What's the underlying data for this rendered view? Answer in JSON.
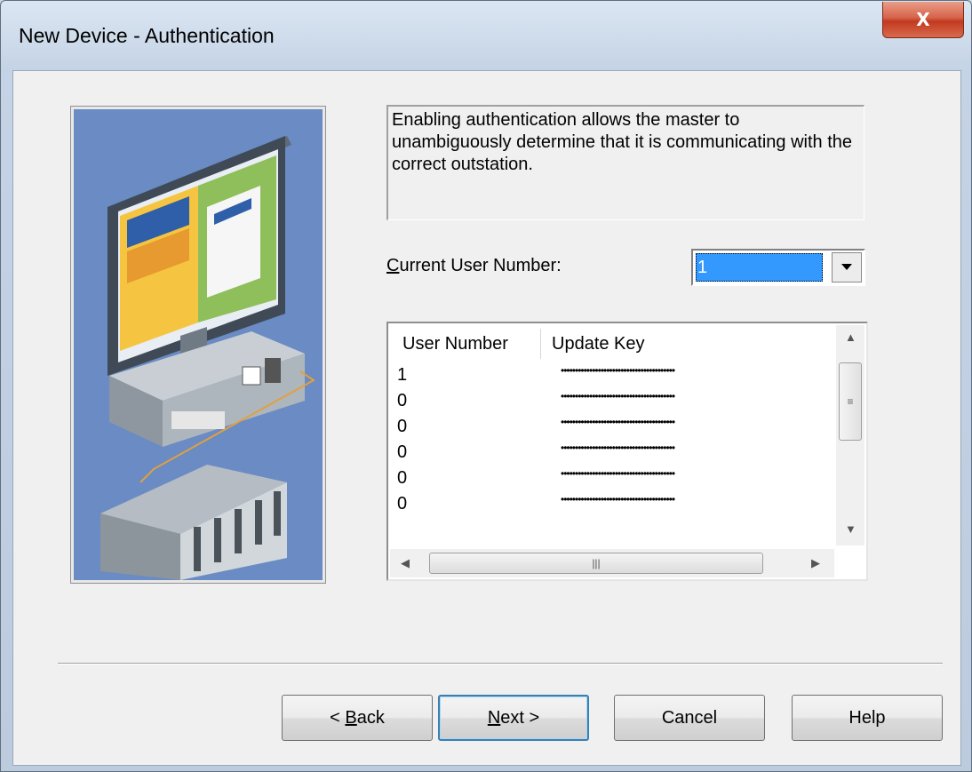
{
  "window": {
    "title": "New Device - Authentication",
    "close_glyph": "X"
  },
  "description": "Enabling authentication allows the master to unambiguously determine that it is communicating with the correct outstation.",
  "current_user": {
    "label_mnemonic": "C",
    "label_rest": "urrent User Number:",
    "value": "1"
  },
  "list": {
    "columns": [
      "User Number",
      "Update Key"
    ],
    "rows": [
      {
        "user_number": "1",
        "update_key": "••••••••••••••••••••••••••••••••••••••••"
      },
      {
        "user_number": "0",
        "update_key": "••••••••••••••••••••••••••••••••••••••••"
      },
      {
        "user_number": "0",
        "update_key": "••••••••••••••••••••••••••••••••••••••••"
      },
      {
        "user_number": "0",
        "update_key": "••••••••••••••••••••••••••••••••••••••••"
      },
      {
        "user_number": "0",
        "update_key": "••••••••••••••••••••••••••••••••••••••••"
      },
      {
        "user_number": "0",
        "update_key": "••••••••••••••••••••••••••••••••••••••••"
      }
    ]
  },
  "buttons": {
    "back": {
      "prefix": "< ",
      "mnemonic": "B",
      "rest": "ack"
    },
    "next": {
      "mnemonic": "N",
      "rest": "ext >"
    },
    "cancel": "Cancel",
    "help": "Help"
  },
  "icons": {
    "close": "close-icon",
    "dropdown": "chevron-down-icon",
    "scroll_up": "arrow-up-icon",
    "scroll_down": "arrow-down-icon",
    "scroll_left": "arrow-left-icon",
    "scroll_right": "arrow-right-icon",
    "illustration": "computer-plc-illustration"
  },
  "colors": {
    "illustration_bg": "#6a8bc3",
    "selection": "#3399ff",
    "close_button": "#c94a31"
  }
}
